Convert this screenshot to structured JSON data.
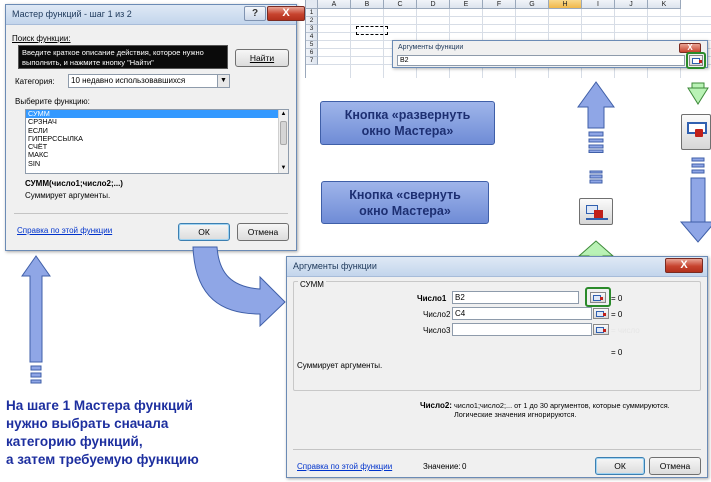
{
  "wizard": {
    "title": "Мастер функций - шаг 1 из 2",
    "help_glyph": "?",
    "close_glyph": "X",
    "search_label": "Поиск функции:",
    "search_value": "Введите краткое описание действия, которое нужно выполнить, и нажмите кнопку \"Найти\"",
    "find_button": "Найти",
    "category_label": "Категория:",
    "category_value": "10 недавно использовавшихся",
    "choose_label": "Выберите функцию:",
    "functions": [
      "СУММ",
      "СРЗНАЧ",
      "ЕСЛИ",
      "ГИПЕРССЫЛКА",
      "СЧЁТ",
      "МАКС",
      "SIN"
    ],
    "signature": "СУММ(число1;число2;...)",
    "description": "Суммирует аргументы.",
    "help_link": "Справка по этой функции",
    "ok": "ОК",
    "cancel": "Отмена"
  },
  "sheet": {
    "columns": [
      "A",
      "B",
      "C",
      "D",
      "E",
      "F",
      "G",
      "H",
      "I",
      "J",
      "K"
    ],
    "rows": [
      "1",
      "2",
      "3",
      "4",
      "5",
      "6",
      "7"
    ],
    "selected_column": "H"
  },
  "collapsed_dialog": {
    "title": "Аргументы функции",
    "value": "B2"
  },
  "callouts": {
    "expand": "Кнопка «развернуть окно Мастера»",
    "collapse": "Кнопка «свернуть окно Мастера»"
  },
  "args_dialog": {
    "title": "Аргументы функции",
    "group": "СУММ",
    "arg1_label": "Число1",
    "arg1_value": "B2",
    "arg1_result": "= 0",
    "arg2_label": "Число2",
    "arg2_value": "C4",
    "arg2_result": "= 0",
    "arg3_label": "Число3",
    "arg3_result": "= число",
    "total_result": "= 0",
    "description": "Суммирует аргументы.",
    "arg_help_label": "Число2:",
    "arg_help_text_1": "число1;число2;... от 1 до 30 аргументов, которые суммируются.",
    "arg_help_text_2": "Логические значения игнорируются.",
    "help_link": "Справка по этой функции",
    "value_label": "Значение:",
    "value": "0",
    "ok": "ОК",
    "cancel": "Отмена"
  },
  "caption": {
    "line1": "На шаге 1 Мастера функций",
    "line2": "нужно выбрать сначала",
    "line3": "категорию функций,",
    "line4": "а затем требуемую функцию"
  },
  "colors": {
    "arrow_blue": "#8fa6e6",
    "arrow_green": "#b9f2b5",
    "callout_text": "#1d2f72",
    "caption_text": "#1d2f9f",
    "highlight_green": "#2a8a2a"
  }
}
